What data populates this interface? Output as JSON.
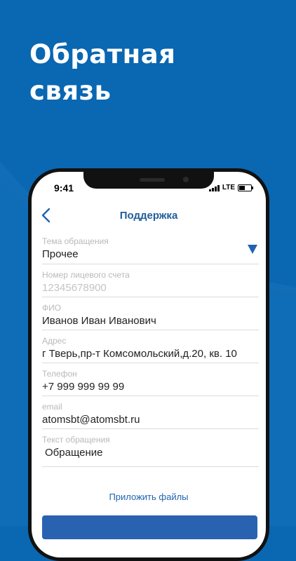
{
  "headline": {
    "line1": "Обратная",
    "line2": "связь"
  },
  "status_bar": {
    "time": "9:41",
    "network": "LTE"
  },
  "nav": {
    "title": "Поддержка"
  },
  "form": {
    "topic": {
      "label": "Тема обращения",
      "value": "Прочее"
    },
    "account": {
      "label": "Номер лицевого счета",
      "placeholder": "12345678900"
    },
    "name": {
      "label": "ФИО",
      "value": "Иванов Иван Иванович"
    },
    "address": {
      "label": "Адрес",
      "value": "г Тверь,пр-т Комсомольский,д.20, кв. 10"
    },
    "phone": {
      "label": "Телефон",
      "value": "+7 999 999 99 99"
    },
    "email": {
      "label": "email",
      "value": "atomsbt@atomsbt.ru"
    },
    "message": {
      "label": "Текст обращения",
      "value": "Обращение"
    }
  },
  "attach_label": "Приложить файлы",
  "submit_label": "",
  "colors": {
    "background": "#0a67b2",
    "accent": "#1f63b0",
    "title": "#1f5e99"
  },
  "icons": {
    "back": "chevron-left-icon",
    "dropdown": "triangle-down-icon"
  }
}
